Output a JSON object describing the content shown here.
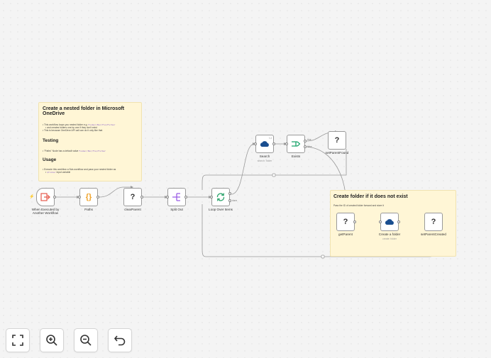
{
  "sticky_main": {
    "title": "Create a nested folder in Microsoft OneDrive",
    "intro_1a": "This workflow loops you nested folder e.g. ",
    "intro_1_code": "Foobar/Bar/Foo/Furbar",
    "intro_1b": "and creates folders one by one if they don't exist",
    "intro_2": "This is because OneDrive API call can do it only like that",
    "testing_heading": "Testing",
    "testing_1a": "\"Paths\" Node has a default value ",
    "testing_1_code": "Foobar/Bar/Foo/Furbar",
    "usage_heading": "Usage",
    "usage_1a": "Execute this workflow a Sub-workflow and pass your nested folder as",
    "usage_1_code": "$folder",
    "usage_1b": " input variable"
  },
  "sticky_create": {
    "title": "Create folder if it does not exist",
    "description": "Pass the ID of created folder forward and store it"
  },
  "nodes": {
    "trigger": {
      "label_line1": "When Executed by",
      "label_line2": "Another Workflow"
    },
    "paths": {
      "label": "Paths"
    },
    "clear_parent": {
      "label": "clearParent",
      "glyph": "?"
    },
    "split_out": {
      "label": "Split Out"
    },
    "loop": {
      "label": "Loop Over Items",
      "output_label": "done"
    },
    "search": {
      "label": "Search",
      "subtitle": "search: folder"
    },
    "exists": {
      "label": "Exists",
      "true_label": "true",
      "false_label": "false"
    },
    "set_parent_found": {
      "label": "setParentFound",
      "glyph": "?"
    },
    "get_parent": {
      "label": "getParent",
      "glyph": "?"
    },
    "create_folder": {
      "label": "Create a folder",
      "subtitle": "create: folder"
    },
    "set_parent_created": {
      "label": "setParentCreated",
      "glyph": "?"
    }
  },
  "controls": {
    "fit_view": "fit-view",
    "zoom_in": "zoom-in",
    "zoom_out": "zoom-out",
    "undo": "undo"
  },
  "colors": {
    "trigger": "#e75a4d",
    "paths": "#f0a32a",
    "split_out": "#9b5de5",
    "loop": "#2aa36b",
    "onedrive": "#1a4e8f",
    "exists": "#1aa36b",
    "edge": "#9a9a9a",
    "sticky": "#fff6d6"
  }
}
